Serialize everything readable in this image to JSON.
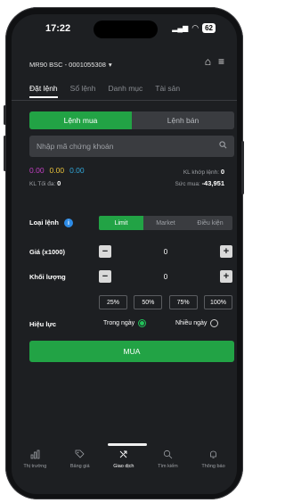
{
  "status": {
    "time": "17:22",
    "battery": "62"
  },
  "account": {
    "label": "MR90 BSC - 0001055308"
  },
  "tabs": [
    "Đặt lệnh",
    "Sổ lệnh",
    "Danh mục",
    "Tài sản"
  ],
  "side_toggle": {
    "buy": "Lệnh mua",
    "sell": "Lệnh bán"
  },
  "search": {
    "placeholder": "Nhập mã chứng khoán"
  },
  "prices": {
    "ceiling": "0.00",
    "ref": "0.00",
    "floor": "0.00"
  },
  "stats": {
    "matched_label": "KL khớp lệnh:",
    "matched_value": "0",
    "max_label": "KL Tối đa:",
    "max_value": "0",
    "buying_power_label": "Sức mua:",
    "buying_power_value": "-43,951"
  },
  "order_type": {
    "label": "Loại lệnh",
    "options": [
      "Limit",
      "Market",
      "Điều kiện"
    ]
  },
  "price": {
    "label": "Giá (x1000)",
    "value": "0"
  },
  "volume": {
    "label": "Khối lượng",
    "value": "0"
  },
  "percents": [
    "25%",
    "50%",
    "75%",
    "100%"
  ],
  "validity": {
    "label": "Hiệu lực",
    "options": [
      "Trong ngày",
      "Nhiều ngày"
    ]
  },
  "submit": {
    "label": "MUA"
  },
  "nav": [
    "Thị trường",
    "Bảng giá",
    "Giao dịch",
    "Tìm kiếm",
    "Thông báo"
  ],
  "colors": {
    "accent": "#22a345",
    "background": "#1d1f22"
  }
}
